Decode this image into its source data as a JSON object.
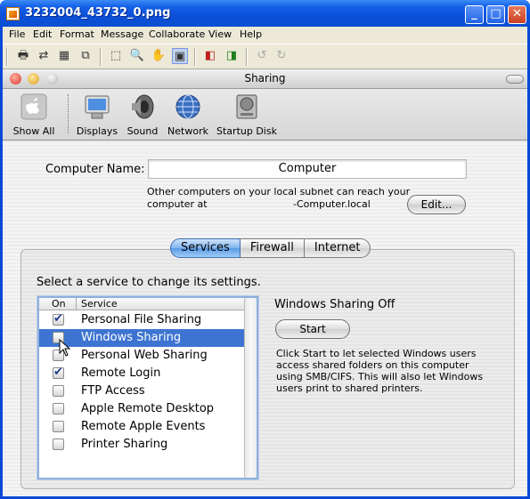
{
  "app_window": {
    "title": "3232004_43732_0.png",
    "controls": {
      "minimize": "_",
      "maximize": "□",
      "close": "✕"
    }
  },
  "menubar": [
    "File",
    "Edit",
    "Format",
    "Message",
    "Collaborate",
    "View",
    "Help"
  ],
  "toolbar_icons": [
    "print-icon",
    "export-icon",
    "grid-icon",
    "copy-icon",
    "select-rect-icon",
    "zoom-icon",
    "pan-hand-icon",
    "fit-page-icon",
    "layout-a-icon",
    "layout-b-icon",
    "rotate-left-icon",
    "rotate-right-icon"
  ],
  "mac_window": {
    "title": "Sharing",
    "toolbar": {
      "show_all": "Show All",
      "items": [
        "Displays",
        "Sound",
        "Network",
        "Startup Disk"
      ]
    }
  },
  "sharing": {
    "computer_name_label": "Computer Name:",
    "computer_name_value": "Computer",
    "subnet_note_line1": "Other computers on your local subnet can reach your",
    "subnet_note_line2_prefix": "computer at",
    "subnet_note_line2_suffix": "-Computer.local",
    "edit_button": "Edit...",
    "tabs": [
      {
        "label": "Services",
        "active": true
      },
      {
        "label": "Firewall",
        "active": false
      },
      {
        "label": "Internet",
        "active": false
      }
    ],
    "instruction": "Select a service to change its settings.",
    "list_header": {
      "on": "On",
      "service": "Service"
    },
    "services": [
      {
        "name": "Personal File Sharing",
        "on": true,
        "selected": false
      },
      {
        "name": "Windows Sharing",
        "on": false,
        "selected": true
      },
      {
        "name": "Personal Web Sharing",
        "on": false,
        "selected": false
      },
      {
        "name": "Remote Login",
        "on": true,
        "selected": false
      },
      {
        "name": "FTP Access",
        "on": false,
        "selected": false
      },
      {
        "name": "Apple Remote Desktop",
        "on": false,
        "selected": false
      },
      {
        "name": "Remote Apple Events",
        "on": false,
        "selected": false
      },
      {
        "name": "Printer Sharing",
        "on": false,
        "selected": false
      }
    ],
    "detail": {
      "status": "Windows Sharing Off",
      "start_button": "Start",
      "description_lines": [
        "Click Start to let selected Windows users",
        "access shared folders on this computer",
        "using SMB/CIFS. This will also let Windows",
        "users print to shared printers."
      ]
    }
  },
  "colors": {
    "xp_blue": "#0a4fd6",
    "selection": "#3d74d1",
    "tab_active": "#5b9be5",
    "mac_bg": "#ececec"
  }
}
